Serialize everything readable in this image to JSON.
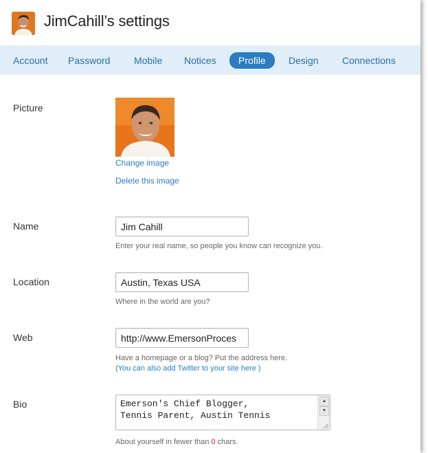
{
  "header": {
    "title": "JimCahill’s settings"
  },
  "tabs": [
    {
      "label": "Account"
    },
    {
      "label": "Password"
    },
    {
      "label": "Mobile"
    },
    {
      "label": "Notices"
    },
    {
      "label": "Profile"
    },
    {
      "label": "Design"
    },
    {
      "label": "Connections"
    }
  ],
  "active_tab": "Profile",
  "picture": {
    "label": "Picture",
    "change_link": "Change image",
    "delete_link": "Delete this image"
  },
  "name": {
    "label": "Name",
    "value": "Jim Cahill",
    "hint": "Enter your real name, so people you know can recognize you."
  },
  "location": {
    "label": "Location",
    "value": "Austin, Texas USA",
    "hint": "Where in the world are you?"
  },
  "web": {
    "label": "Web",
    "value": "http://www.EmersonProces",
    "hint": "Have a homepage or a blog? Put the address here.",
    "hint_link": "(You can also add Twitter to your site here )"
  },
  "bio": {
    "label": "Bio",
    "value": "Emerson's Chief Blogger,\nTennis Parent, Austin Tennis",
    "hint_prefix": "About yourself in fewer than",
    "hint_count": "0",
    "hint_suffix": "chars."
  },
  "colors": {
    "tab_bar": "#dfeef8",
    "active_tab": "#2b7cc1",
    "link": "#2b7cc1",
    "char_count": "#d21e1e"
  }
}
